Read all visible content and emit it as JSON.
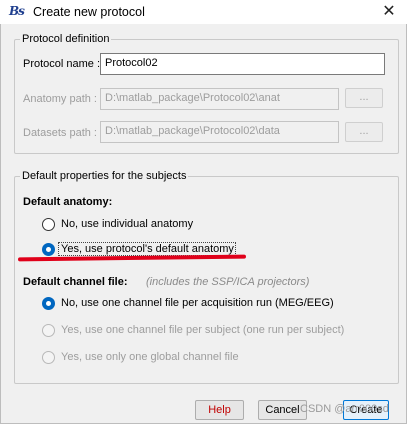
{
  "window": {
    "title": "Create new protocol",
    "app_icon": "Bs",
    "close_symbol": "✕"
  },
  "protocol_definition": {
    "group_label": "Protocol definition",
    "name_label": "Protocol name :",
    "name_value": "Protocol02",
    "anatomy_label": "Anatomy path :",
    "anatomy_value": "D:\\matlab_package\\Protocol02\\anat",
    "datasets_label": "Datasets path :",
    "datasets_value": "D:\\matlab_package\\Protocol02\\data",
    "browse_label": "..."
  },
  "defaults": {
    "group_label": "Default properties for the subjects",
    "anatomy_heading": "Default anatomy:",
    "anatomy_options": [
      {
        "label": "No, use individual anatomy",
        "checked": false,
        "enabled": true
      },
      {
        "label": "Yes, use protocol's default anatomy",
        "checked": true,
        "enabled": true
      }
    ],
    "channel_heading": "Default channel file:",
    "channel_note": "(includes the SSP/ICA projectors)",
    "channel_options": [
      {
        "label": "No, use one channel file per acquisition run (MEG/EEG)",
        "checked": true,
        "enabled": true
      },
      {
        "label": "Yes, use one channel file per subject  (one run per subject)",
        "checked": false,
        "enabled": false
      },
      {
        "label": "Yes, use only one global channel file",
        "checked": false,
        "enabled": false
      }
    ]
  },
  "buttons": {
    "help": "Help",
    "cancel": "Cancel",
    "create": "Create"
  },
  "colors": {
    "help_text": "#c00000",
    "annotation": "#e0001a",
    "radio_selected": "#0067c0"
  },
  "watermark": "CSDN @arr000sd"
}
